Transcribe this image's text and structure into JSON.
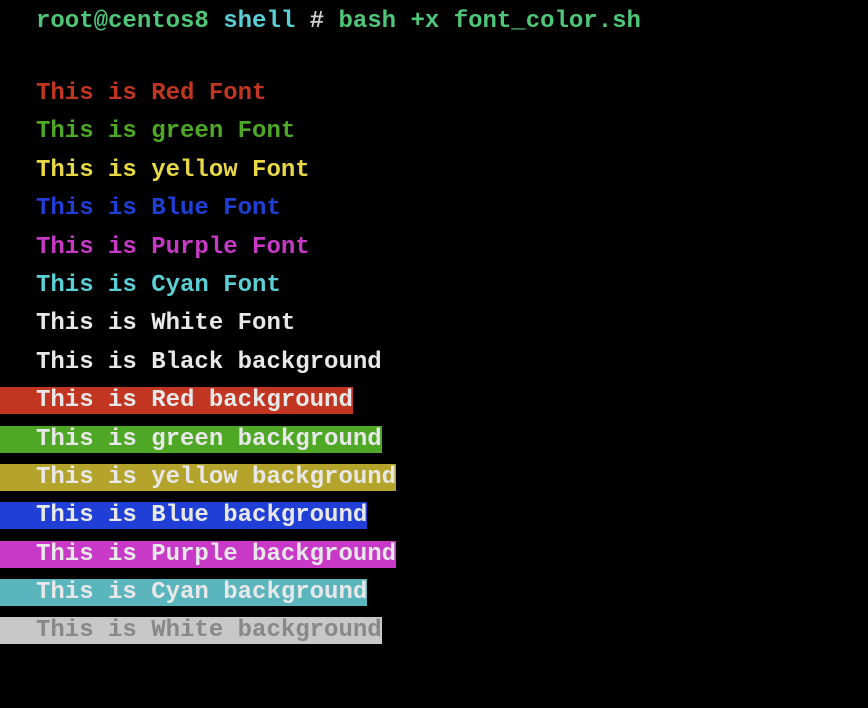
{
  "prompt": {
    "user": "root@centos8",
    "path": "shell",
    "separator": "#",
    "command": "bash +x font_color.sh"
  },
  "lines": [
    {
      "text": "This is Red Font",
      "class": "font-red",
      "bg": false
    },
    {
      "text": "This is green Font",
      "class": "font-green",
      "bg": false
    },
    {
      "text": "This is yellow Font",
      "class": "font-yellow",
      "bg": false
    },
    {
      "text": "This is Blue Font",
      "class": "font-blue",
      "bg": false
    },
    {
      "text": "This is Purple Font",
      "class": "font-purple",
      "bg": false
    },
    {
      "text": "This is Cyan Font",
      "class": "font-cyan",
      "bg": false
    },
    {
      "text": "This is White Font",
      "class": "font-white",
      "bg": false
    },
    {
      "text": "This is Black background",
      "class": "bg-black",
      "bg": true
    },
    {
      "text": "This is Red background",
      "class": "bg-red",
      "bg": true
    },
    {
      "text": "This is green background",
      "class": "bg-green",
      "bg": true
    },
    {
      "text": "This is yellow background",
      "class": "bg-yellow",
      "bg": true
    },
    {
      "text": "This is Blue background",
      "class": "bg-blue",
      "bg": true
    },
    {
      "text": "This is Purple background",
      "class": "bg-purple",
      "bg": true
    },
    {
      "text": "This is Cyan background",
      "class": "bg-cyan",
      "bg": true
    },
    {
      "text": "This is White background",
      "class": "bg-white",
      "bg": true
    }
  ]
}
